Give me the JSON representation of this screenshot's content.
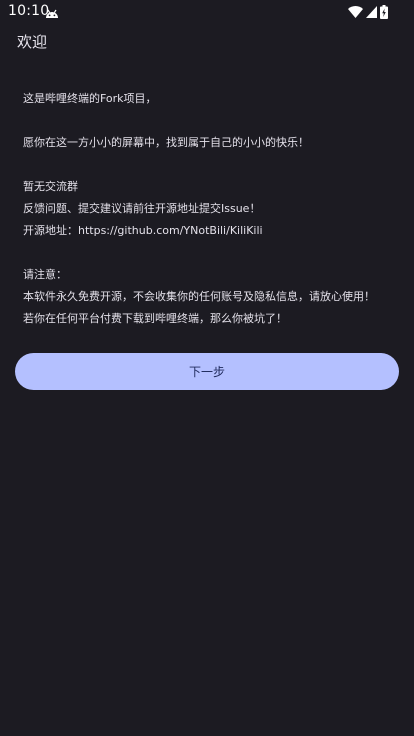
{
  "status_bar": {
    "time": "10:10",
    "icons": [
      "debug-android-icon",
      "wifi-icon",
      "cell-signal-icon",
      "battery-charging-icon"
    ]
  },
  "header": {
    "title": "欢迎"
  },
  "content": {
    "lines": [
      "这是哔哩终端的Fork项目，",
      "愿你在这一方小小的屏幕中，找到属于自己的小小的快乐！",
      "暂无交流群",
      "反馈问题、提交建议请前往开源地址提交Issue！",
      "开源地址：https://github.com/YNotBili/KiliKili",
      "请注意：",
      "本软件永久免费开源，不会收集你的任何账号及隐私信息，请放心使用！",
      "若你在任何平台付费下载到哔哩终端，那么你被坑了！"
    ]
  },
  "actions": {
    "next_label": "下一步"
  },
  "colors": {
    "background": "#1c1b22",
    "button_background": "#b4c0ff",
    "button_text": "#1f2a5c",
    "text": "#e4e1ea"
  }
}
